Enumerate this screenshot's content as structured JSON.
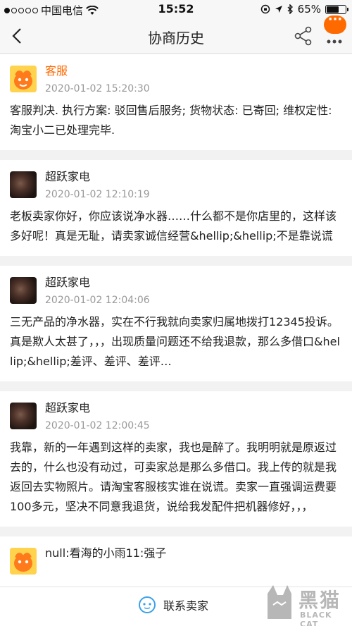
{
  "status_bar": {
    "carrier": "中国电信",
    "time": "15:52",
    "battery_text": "65%",
    "battery_level": 0.65
  },
  "nav": {
    "title": "协商历史",
    "badge_text": "···"
  },
  "records": [
    {
      "author": "客服",
      "avatar": "service-mascot",
      "time": "2020-01-02 15:20:30",
      "content": "客服判决. 执行方案: 驳回售后服务; 货物状态: 已寄回; 维权定性: 淘宝小二已处理完毕."
    },
    {
      "author": "超跃家电",
      "avatar": "store-photo",
      "time": "2020-01-02 12:10:19",
      "content": "老板卖家你好，你应该说净水器……什么都不是你店里的，这样该多好呢！真是无耻，请卖家诚信经营&hellip;&hellip;不是靠说谎"
    },
    {
      "author": "超跃家电",
      "avatar": "store-photo",
      "time": "2020-01-02 12:04:06",
      "content": "三无产品的净水器，实在不行我就向卖家归属地拨打12345投诉。真是欺人太甚了，，，出现质量问题还不给我退款，那么多借口&hellip;&hellip;差评、差评、差评…"
    },
    {
      "author": "超跃家电",
      "avatar": "store-photo",
      "time": "2020-01-02 12:00:45",
      "content": "我靠，新的一年遇到这样的卖家，我也是醉了。我明明就是原返过去的，什么也没有动过，可卖家总是那么多借口。我上传的就是我返回去实物照片。请淘宝客服核实谁在说谎。卖家一直强调运费要100多元，坚决不同意我退货，说给我发配件把机器修好，，，"
    },
    {
      "author": "null:看海的小雨11:强子",
      "avatar": "service-mascot",
      "time": "",
      "content": ""
    }
  ],
  "bottom": {
    "contact_label": "联系卖家"
  },
  "watermark": {
    "text": "黑猫",
    "sub": "BLACK CAT"
  },
  "colors": {
    "accent": "#ff6a00",
    "background": "#f2f2f2",
    "secondary_text": "#999999"
  }
}
